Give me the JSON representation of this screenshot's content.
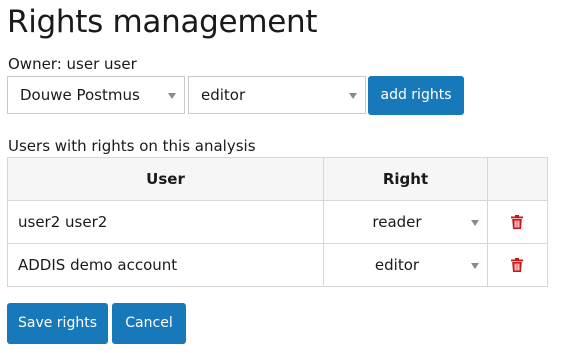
{
  "page": {
    "title": "Rights management",
    "owner_label": "Owner: user user"
  },
  "add_form": {
    "user_select": {
      "selected": "Douwe Postmus"
    },
    "role_select": {
      "selected": "editor"
    },
    "add_button_label": "add rights"
  },
  "rights_table": {
    "section_label": "Users with rights on this analysis",
    "headers": {
      "user": "User",
      "right": "Right"
    },
    "rows": [
      {
        "user": "user2 user2",
        "right": "reader"
      },
      {
        "user": "ADDIS demo account",
        "right": "editor"
      }
    ]
  },
  "actions": {
    "save_label": "Save rights",
    "cancel_label": "Cancel"
  },
  "colors": {
    "primary": "#1779ba",
    "delete": "#cc1414"
  },
  "icons": {
    "delete": "trash-icon",
    "dropdown": "chevron-down-icon"
  }
}
